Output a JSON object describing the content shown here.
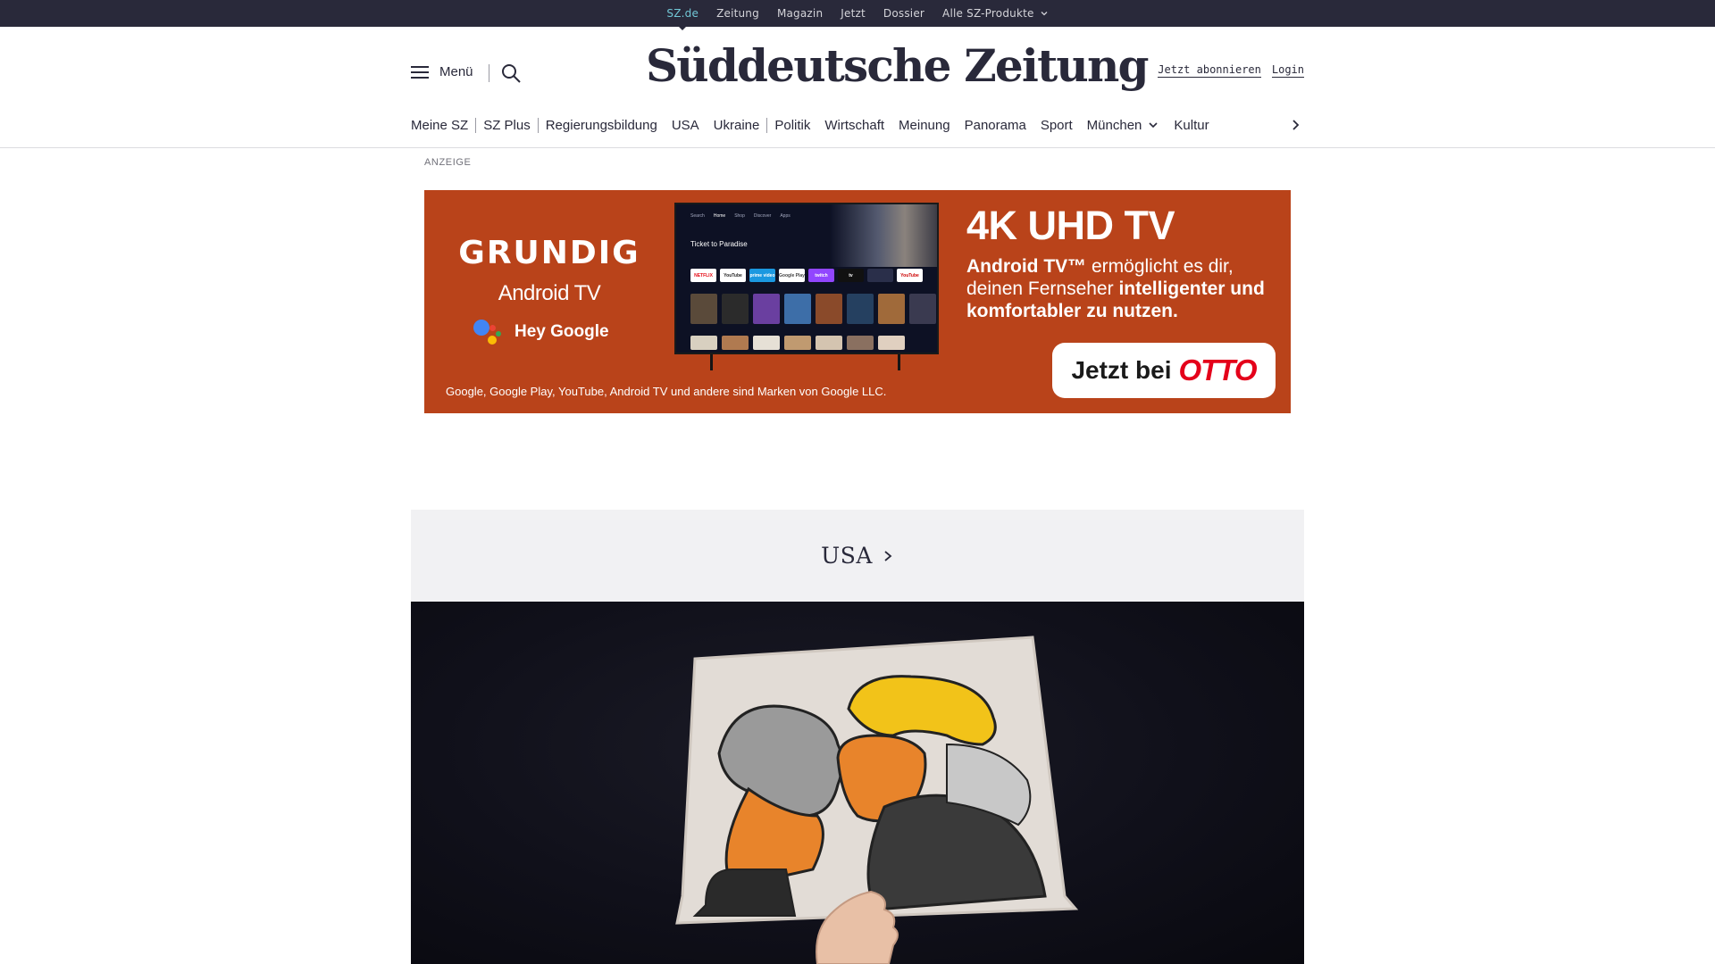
{
  "topbar": {
    "items": [
      {
        "label": "SZ.de",
        "active": true
      },
      {
        "label": "Zeitung"
      },
      {
        "label": "Magazin"
      },
      {
        "label": "Jetzt"
      },
      {
        "label": "Dossier"
      },
      {
        "label": "Alle SZ-Produkte",
        "has_dropdown": true
      }
    ]
  },
  "header": {
    "menu_label": "Menü",
    "logo": "Süddeutsche Zeitung",
    "subscribe_label": "Jetzt abonnieren",
    "login_label": "Login"
  },
  "deptnav": {
    "items": [
      {
        "label": "Meine SZ"
      },
      {
        "label": "SZ Plus"
      },
      {
        "label": "Regierungsbildung"
      },
      {
        "label": "USA"
      },
      {
        "label": "Ukraine"
      },
      {
        "label": "Politik"
      },
      {
        "label": "Wirtschaft"
      },
      {
        "label": "Meinung"
      },
      {
        "label": "Panorama"
      },
      {
        "label": "Sport"
      },
      {
        "label": "München",
        "has_dropdown": true
      },
      {
        "label": "Kultur"
      }
    ]
  },
  "ad": {
    "label": "ANZEIGE",
    "brand": "GRUNDIG",
    "platform": "Android TV",
    "assistant": "Hey Google",
    "headline": "4K UHD TV",
    "copy_1_bold": "Android TV™",
    "copy_1_regular": " ermöglicht es dir, deinen Fernseher ",
    "copy_2_bold": "intelligenter und komfortabler zu nutzen.",
    "cta_prefix": "Jetzt bei",
    "cta_brand": "OTTO",
    "disclaimer": "Google, Google Play, YouTube, Android TV und andere sind Marken von Google LLC.",
    "tv_title": "Ticket to Paradise",
    "tv_tabs": [
      "Search",
      "Home",
      "Shop",
      "Discover",
      "Apps"
    ],
    "tv_apps": [
      "NETFLIX",
      "YouTube",
      "prime video",
      "Google Play",
      "twitch",
      "tv",
      "",
      "YouTube"
    ],
    "background_color": "#b9431a",
    "cta_brand_color": "#e4001a"
  },
  "section": {
    "title": "USA"
  },
  "colors": {
    "topbar_bg": "#29293a",
    "topbar_active": "#71c7d6",
    "text": "#29293a",
    "section_bg": "#f1f1f3"
  }
}
